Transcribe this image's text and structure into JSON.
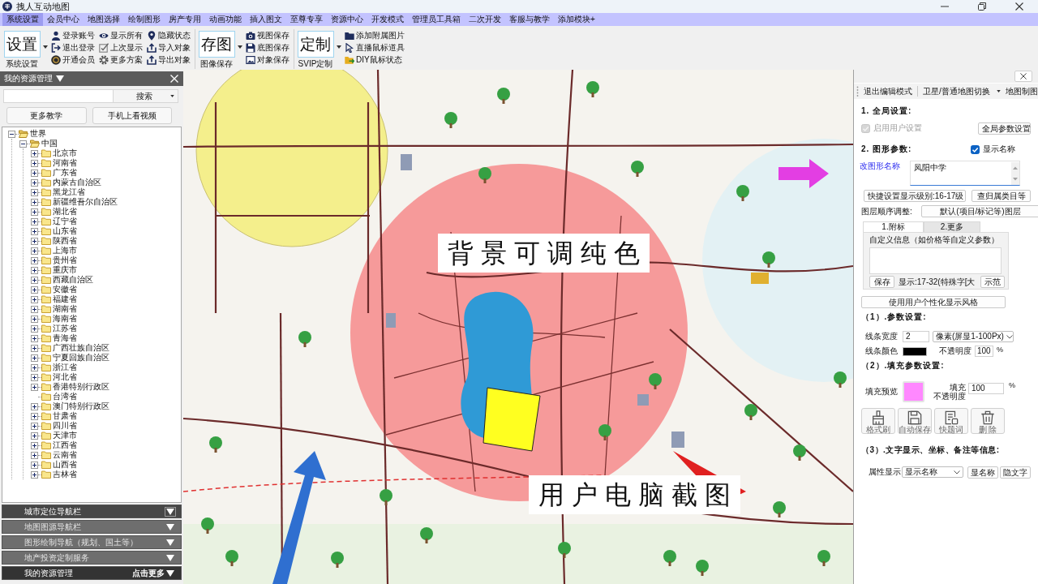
{
  "window": {
    "title": "拽人互动地图"
  },
  "menu": [
    {
      "label": "系统设置",
      "selected": true
    },
    {
      "label": "会员中心",
      "selected": false
    },
    {
      "label": "地图选择",
      "selected": false
    },
    {
      "label": "绘制图形",
      "selected": false
    },
    {
      "label": "房产专用",
      "selected": false
    },
    {
      "label": "动画功能",
      "selected": false
    },
    {
      "label": "插入图文",
      "selected": false
    },
    {
      "label": "至尊专享",
      "selected": false
    },
    {
      "label": "资源中心",
      "selected": false
    },
    {
      "label": "开发模式",
      "selected": false
    },
    {
      "label": "管理员工具箱",
      "selected": false
    },
    {
      "label": "二次开发",
      "selected": false
    },
    {
      "label": "客服与教学",
      "selected": false
    },
    {
      "label": "添加模块+",
      "selected": false
    }
  ],
  "ribbon": [
    {
      "big": "设置",
      "caption": "系统设置",
      "actions": [
        "登录账号",
        "退出登录",
        "开通会员",
        "显示所有",
        "上次显示",
        "更多方案",
        "隐藏状态",
        "导入对象",
        "导出对象"
      ]
    },
    {
      "big": "存图",
      "caption": "图像保存",
      "actions": [
        "视图保存",
        "底图保存",
        "对象保存"
      ]
    },
    {
      "big": "定制",
      "caption": "SVIP定制",
      "actions": [
        "添加附属图片",
        "直播鼠标道具",
        "DIY鼠标状态"
      ]
    }
  ],
  "resource_panel": {
    "title": "我的资源管理",
    "search_button": "搜索",
    "buttons": [
      "更多教学",
      "手机上看视频"
    ],
    "tree": [
      {
        "label": "世界",
        "expandable": true,
        "expanded": true,
        "children": [
          {
            "label": "中国",
            "expandable": true,
            "expanded": true,
            "children": [
              {
                "label": "北京市",
                "expandable": true,
                "expanded": false
              },
              {
                "label": "河南省",
                "expandable": true,
                "expanded": false
              },
              {
                "label": "广东省",
                "expandable": true,
                "expanded": false
              },
              {
                "label": "内蒙古自治区",
                "expandable": true,
                "expanded": false
              },
              {
                "label": "黑龙江省",
                "expandable": true,
                "expanded": false
              },
              {
                "label": "新疆维吾尔自治区",
                "expandable": true,
                "expanded": false
              },
              {
                "label": "湖北省",
                "expandable": true,
                "expanded": false
              },
              {
                "label": "辽宁省",
                "expandable": true,
                "expanded": false
              },
              {
                "label": "山东省",
                "expandable": true,
                "expanded": false
              },
              {
                "label": "陕西省",
                "expandable": true,
                "expanded": false
              },
              {
                "label": "上海市",
                "expandable": true,
                "expanded": false
              },
              {
                "label": "贵州省",
                "expandable": true,
                "expanded": false
              },
              {
                "label": "重庆市",
                "expandable": true,
                "expanded": false
              },
              {
                "label": "西藏自治区",
                "expandable": true,
                "expanded": false
              },
              {
                "label": "安徽省",
                "expandable": true,
                "expanded": false
              },
              {
                "label": "福建省",
                "expandable": true,
                "expanded": false
              },
              {
                "label": "湖南省",
                "expandable": true,
                "expanded": false
              },
              {
                "label": "海南省",
                "expandable": true,
                "expanded": false
              },
              {
                "label": "江苏省",
                "expandable": true,
                "expanded": false
              },
              {
                "label": "青海省",
                "expandable": true,
                "expanded": false
              },
              {
                "label": "广西壮族自治区",
                "expandable": true,
                "expanded": false
              },
              {
                "label": "宁夏回族自治区",
                "expandable": true,
                "expanded": false
              },
              {
                "label": "浙江省",
                "expandable": true,
                "expanded": false
              },
              {
                "label": "河北省",
                "expandable": true,
                "expanded": false
              },
              {
                "label": "香港特别行政区",
                "expandable": true,
                "expanded": false
              },
              {
                "label": "台湾省",
                "expandable": false,
                "expanded": false
              },
              {
                "label": "澳门特别行政区",
                "expandable": true,
                "expanded": false
              },
              {
                "label": "甘肃省",
                "expandable": true,
                "expanded": false
              },
              {
                "label": "四川省",
                "expandable": true,
                "expanded": false
              },
              {
                "label": "天津市",
                "expandable": true,
                "expanded": false
              },
              {
                "label": "江西省",
                "expandable": true,
                "expanded": false
              },
              {
                "label": "云南省",
                "expandable": true,
                "expanded": false
              },
              {
                "label": "山西省",
                "expandable": true,
                "expanded": false
              },
              {
                "label": "吉林省",
                "expandable": true,
                "expanded": false
              }
            ]
          }
        ]
      }
    ]
  },
  "nav_bars": [
    {
      "label": "城市定位导航栏",
      "hovered": true,
      "selected": false
    },
    {
      "label": "地图图源导航栏",
      "hovered": false,
      "selected": false
    },
    {
      "label": "图形绘制导航（规划、国土等）",
      "hovered": false,
      "selected": false
    },
    {
      "label": "地产投资定制服务",
      "hovered": false,
      "selected": false
    },
    {
      "label": "我的资源管理",
      "hovered": false,
      "selected": true,
      "more": "点击更多"
    }
  ],
  "map": {
    "captions": [
      "背景可调纯色",
      "用户电脑截图"
    ]
  },
  "editor": {
    "toolbar": [
      {
        "label": "退出编辑模式",
        "dropdown": false
      },
      {
        "label": "卫星/普通地图切换",
        "dropdown": true
      },
      {
        "label": "地图制图",
        "dropdown": false
      }
    ],
    "global": {
      "heading": "1. 全局设置:",
      "option": {
        "label": "启用用户设置",
        "checked": true,
        "disabled": true
      },
      "button": "全局参数设置"
    },
    "shape": {
      "heading": "2. 图形参数:",
      "option": {
        "label": "显示名称",
        "checked": true,
        "disabled": false
      },
      "name_label": "改图形名称",
      "name_value": "凤阳中学",
      "level_button": "快捷设置显示级别:16-17级",
      "category_button": "查归属类目等",
      "layer_label": "图层顺序调整:",
      "layer_button": "默认(项目/标记等)图层",
      "tabs": [
        {
          "label": "1.附标",
          "selected": true
        },
        {
          "label": "2.更多",
          "selected": false
        }
      ],
      "custom_label": "自定义信息（如价格等自定义参数）",
      "save_button": "保存",
      "display_note": "显示:17-32(特殊字[大",
      "demo_button": "示范",
      "style_button": "使用用户个性化显示风格"
    },
    "line": {
      "heading": "（1）.参数设置:",
      "width_label": "线条宽度",
      "width_value": "2",
      "unit_value": "像素(屏显1-100Px)",
      "color_label": "线条颜色",
      "color": "#000000",
      "opacity_label": "不透明度",
      "opacity_value": "100",
      "percent": "%"
    },
    "fill": {
      "heading": "（2）.填充参数设置:",
      "preview_label": "填充预览",
      "color": "#ff88ff",
      "opacity_label_lines": [
        "填充",
        "不透明度"
      ],
      "opacity_value": "100",
      "percent": "%",
      "tools": [
        "格式刷",
        "自动保存",
        "快题词",
        "删 除"
      ]
    },
    "text": {
      "heading": "（3）.文字显示、坐标、备注等信息:",
      "attr_label": "属性显示",
      "attr_value": "显示名称",
      "buttons": [
        "显名称",
        "隐文字"
      ]
    }
  }
}
